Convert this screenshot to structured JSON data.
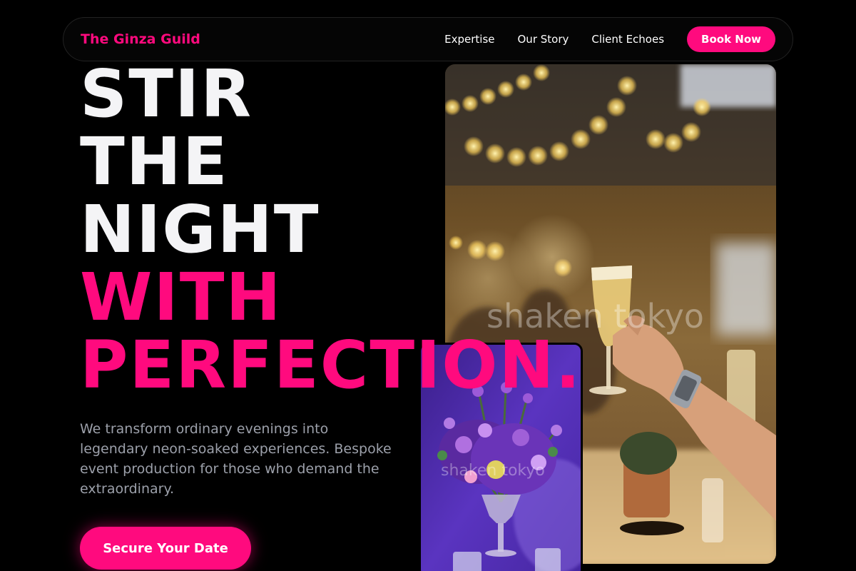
{
  "nav": {
    "brand": "The Ginza Guild",
    "links": [
      "Expertise",
      "Our Story",
      "Client Echoes"
    ],
    "cta_label": "Book Now"
  },
  "hero": {
    "headline_lines": [
      "STIR",
      "THE",
      "NIGHT",
      "WITH",
      "PERFECTION."
    ],
    "description": "We transform ordinary evenings into legendary neon-soaked experiences. Bespoke event production for those who demand the extraordinary.",
    "cta_label": "Secure Your Date"
  },
  "images": {
    "main_watermark": "shaken tokyo",
    "secondary_watermark": "shaken tokyo"
  },
  "colors": {
    "accent": "#ff0a7e",
    "background": "#000000",
    "text_muted": "#9ca0aa"
  }
}
